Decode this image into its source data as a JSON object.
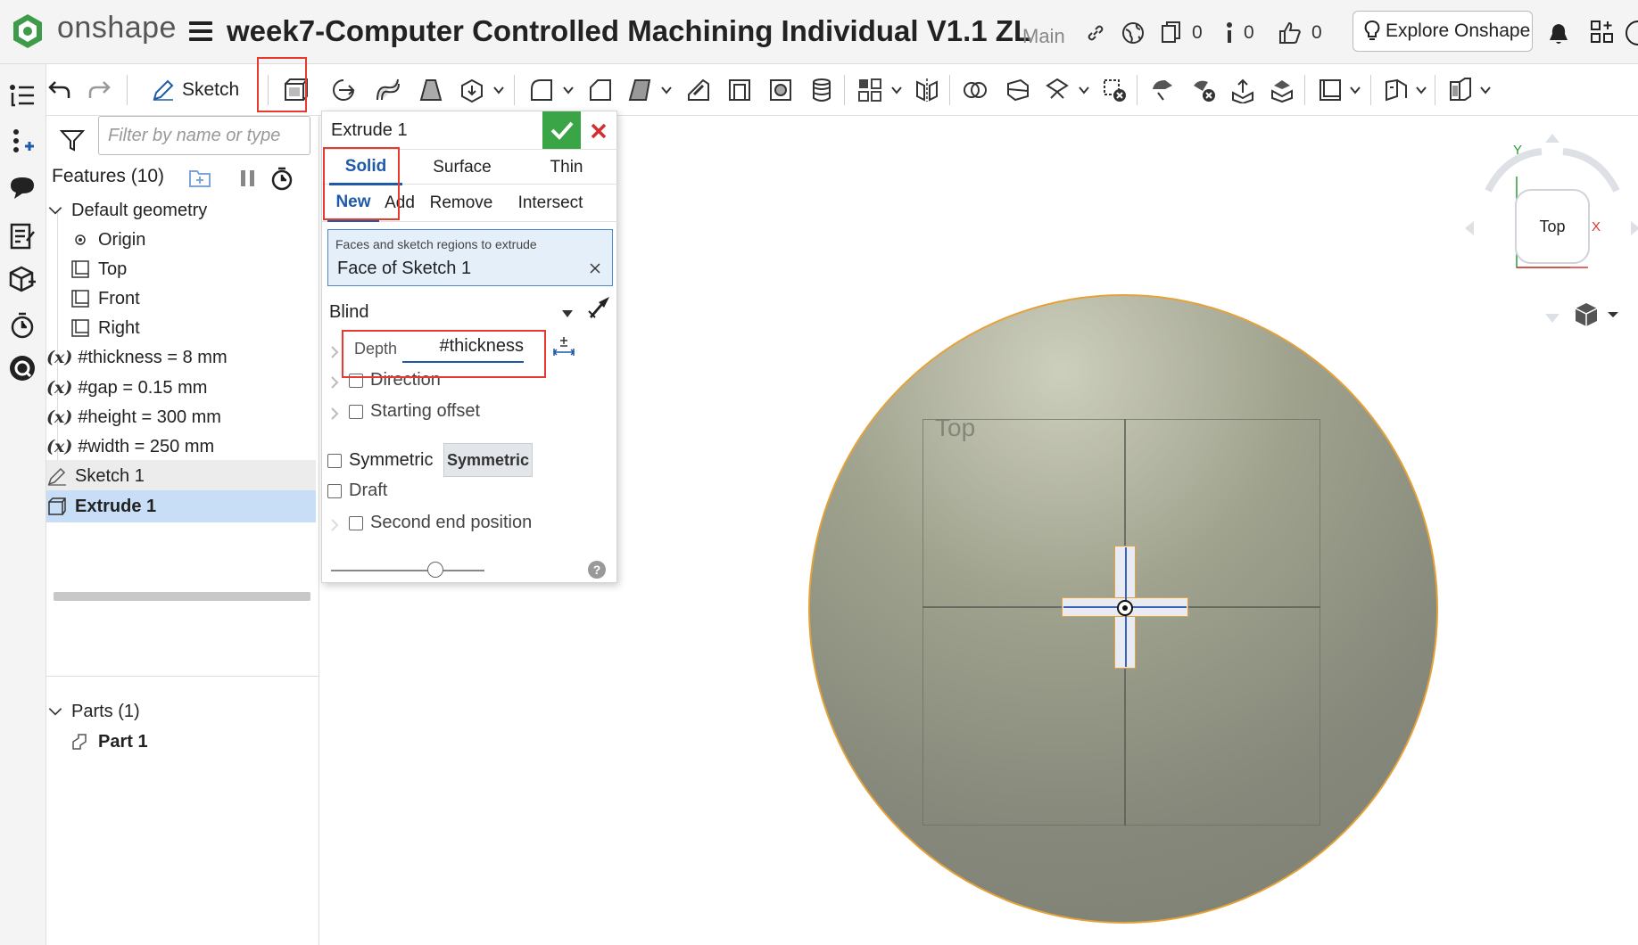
{
  "app": {
    "brand": "onshape",
    "document_title": "week7-Computer Controlled Machining Individual V1.1 ZL",
    "branch": "Main",
    "versions_count": "0",
    "info_count": "0",
    "likes_count": "0",
    "explore_label": "Explore Onshape"
  },
  "toolbar": {
    "sketch_label": "Sketch"
  },
  "features": {
    "filter_placeholder": "Filter by name or type",
    "header": "Features (10)",
    "default_geometry": "Default geometry",
    "origin": "Origin",
    "top": "Top",
    "front": "Front",
    "right": "Right",
    "variables": [
      {
        "name": "#thickness = 8 mm"
      },
      {
        "name": "#gap = 0.15 mm"
      },
      {
        "name": "#height = 300 mm"
      },
      {
        "name": "#width = 250 mm"
      }
    ],
    "var_symbol": "(x)",
    "sketch": "Sketch 1",
    "extrude": "Extrude 1",
    "parts_header": "Parts (1)",
    "part": "Part 1"
  },
  "extrude": {
    "title": "Extrude 1",
    "body_tabs": [
      "Solid",
      "Surface",
      "Thin"
    ],
    "op_tabs": [
      "New",
      "Add",
      "Remove",
      "Intersect"
    ],
    "selection_label": "Faces and sketch regions to extrude",
    "selection_value": "Face of Sketch 1",
    "end_type": "Blind",
    "depth_label": "Depth",
    "depth_value": "#thickness",
    "direction": "Direction",
    "starting_offset": "Starting offset",
    "symmetric": "Symmetric",
    "symmetric_button": "Symmetric",
    "draft": "Draft",
    "second_end": "Second end position",
    "help": "?"
  },
  "viewport": {
    "plane_label": "Top",
    "view_face": "Top",
    "axis_x": "X",
    "axis_y": "Y"
  },
  "colors": {
    "accent_blue": "#1e5aa8",
    "confirm_green": "#3aa547",
    "cancel_red": "#d32f2f",
    "highlight_red": "#e8392f",
    "part_edge": "#e5a23a"
  }
}
